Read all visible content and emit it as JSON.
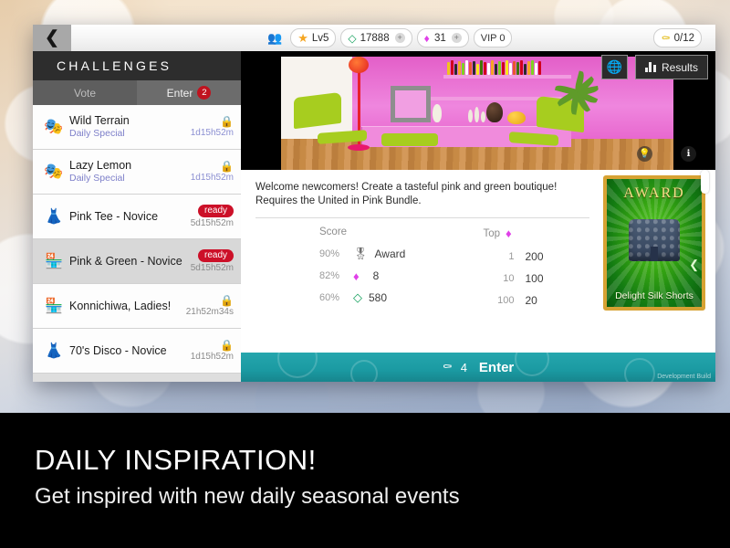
{
  "statusbar": {
    "back_icon": "chevron-left-icon",
    "friends_icon": "friends-icon",
    "level": "Lv5",
    "level_icon": "star-icon",
    "cash": "17888",
    "cash_icon": "cash-icon",
    "gems": "31",
    "gem_icon": "gem-icon",
    "vip": "VIP 0",
    "keys": "0/12",
    "key_icon": "key-icon",
    "plus": "+"
  },
  "panel": {
    "title": "CHALLENGES",
    "tabs": [
      {
        "label": "Vote",
        "badge": "",
        "active": false
      },
      {
        "label": "Enter",
        "badge": "2",
        "active": true
      }
    ],
    "rows": [
      {
        "name": "Wild Terrain",
        "sub": "Daily Special",
        "icon": "mask-icon",
        "state": "locked",
        "status": "",
        "timer": "1d15h52m",
        "selected": false
      },
      {
        "name": "Lazy Lemon",
        "sub": "Daily Special",
        "icon": "mask-icon",
        "state": "locked",
        "status": "",
        "timer": "1d15h52m",
        "selected": false
      },
      {
        "name": "Pink Tee - Novice",
        "sub": "",
        "icon": "dress-icon",
        "state": "ready",
        "status": "ready",
        "timer": "5d15h52m",
        "selected": false
      },
      {
        "name": "Pink & Green - Novice",
        "sub": "",
        "icon": "store-icon",
        "state": "ready",
        "status": "ready",
        "timer": "5d15h52m",
        "selected": true
      },
      {
        "name": "Konnichiwa, Ladies!",
        "sub": "",
        "icon": "store-icon",
        "state": "locked",
        "status": "",
        "timer": "21h52m34s",
        "selected": false
      },
      {
        "name": "70's Disco - Novice",
        "sub": "",
        "icon": "dress-icon",
        "state": "locked",
        "status": "",
        "timer": "1d15h52m",
        "selected": false
      }
    ]
  },
  "detail": {
    "globe_button_icon": "globe-icon",
    "results_button": "Results",
    "results_icon": "bar-chart-icon",
    "hint_icon": "lightbulb-icon",
    "info_icon": "info-icon",
    "description": "Welcome newcomers! Create a tasteful pink and green boutique! Requires the United in Pink Bundle.",
    "score_table": {
      "header": "Score",
      "rows": [
        {
          "pct": "90%",
          "icon": "award-ribbon-icon",
          "value": "Award"
        },
        {
          "pct": "82%",
          "icon": "gem-icon",
          "value": "8"
        },
        {
          "pct": "60%",
          "icon": "cash-icon",
          "value": "580"
        }
      ]
    },
    "top_table": {
      "header": "Top",
      "header_icon": "gem-icon",
      "rows": [
        {
          "rank": "1",
          "amount": "200"
        },
        {
          "rank": "10",
          "amount": "100"
        },
        {
          "rank": "100",
          "amount": "20"
        }
      ]
    },
    "award": {
      "title": "AWARD",
      "item_name": "Delight Silk Shorts",
      "prev_icon": "chevron-left-icon"
    },
    "enter_bar": {
      "key_icon": "key-icon",
      "key_cost": "4",
      "label": "Enter"
    },
    "watermark": "Development Build"
  },
  "caption": {
    "headline": "DAILY INSPIRATION!",
    "subline": "Get inspired with new daily seasonal events"
  },
  "colors": {
    "accent_teal": "#1b9aa2",
    "badge_red": "#c0131f",
    "ready_red": "#cc1028",
    "gem_pink": "#e040e8",
    "cash_green": "#12a05c",
    "sub_purple": "#7d7fc9",
    "award_gold": "#d7a233"
  }
}
